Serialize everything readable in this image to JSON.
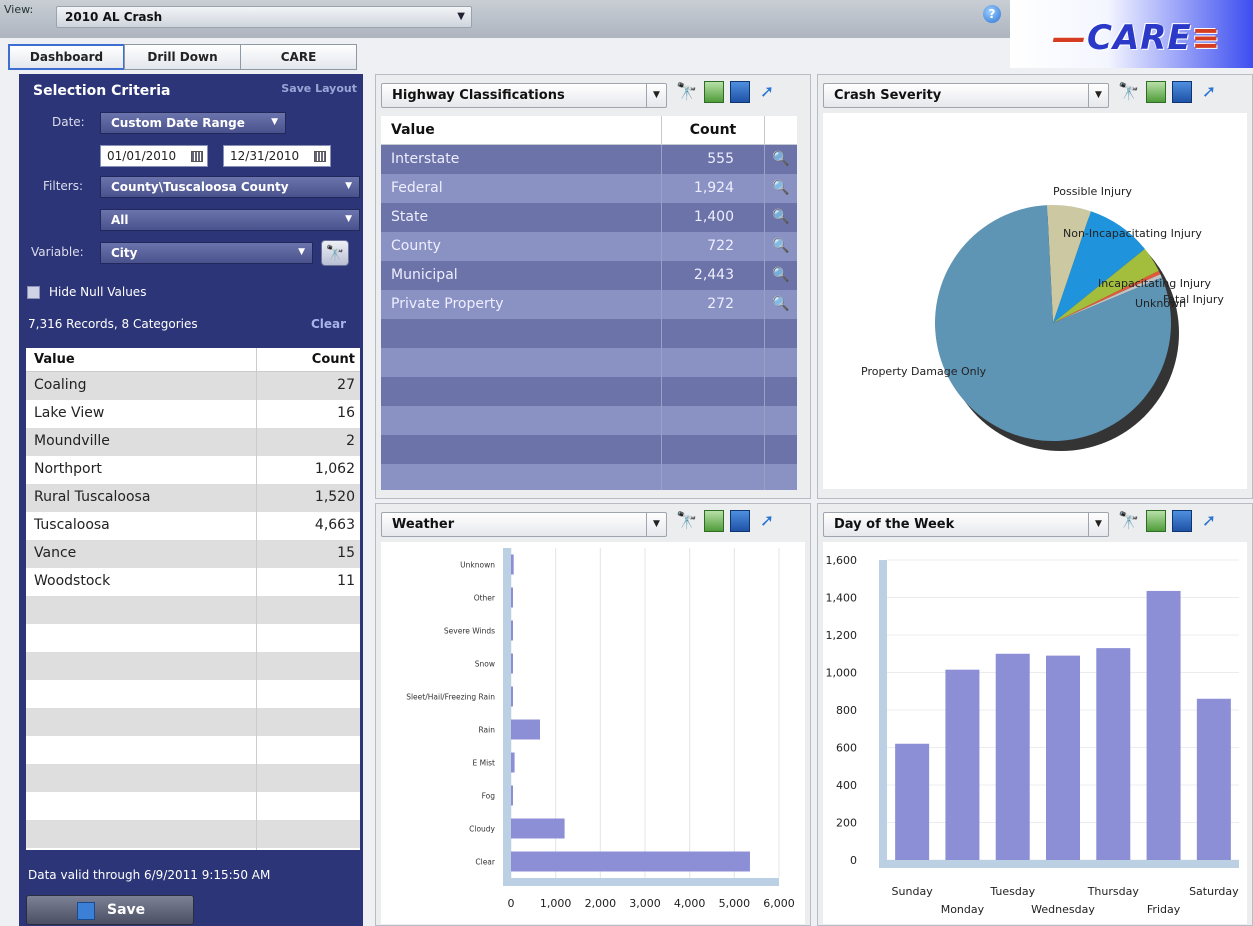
{
  "header": {
    "view_label": "View:",
    "view_value": "2010 AL Crash",
    "help": "?",
    "logo": "CARE"
  },
  "tabs": [
    {
      "label": "Dashboard",
      "active": true
    },
    {
      "label": "Drill Down",
      "active": false
    },
    {
      "label": "CARE",
      "active": false
    }
  ],
  "selection": {
    "title": "Selection Criteria",
    "save_layout": "Save Layout",
    "date_label": "Date:",
    "date_range": "Custom Date Range",
    "start_date": "01/01/2010",
    "end_date": "12/31/2010",
    "filters_label": "Filters:",
    "filter1": "County\\Tuscaloosa County",
    "filter2": "All",
    "variable_label": "Variable:",
    "variable": "City",
    "hide_null": "Hide Null Values",
    "records": "7,316 Records, 8 Categories",
    "clear": "Clear",
    "table_headers": {
      "value": "Value",
      "count": "Count"
    },
    "rows": [
      {
        "value": "Coaling",
        "count": "27"
      },
      {
        "value": "Lake View",
        "count": "16"
      },
      {
        "value": "Moundville",
        "count": "2"
      },
      {
        "value": "Northport",
        "count": "1,062"
      },
      {
        "value": "Rural Tuscaloosa",
        "count": "1,520"
      },
      {
        "value": "Tuscaloosa",
        "count": "4,663"
      },
      {
        "value": "Vance",
        "count": "15"
      },
      {
        "value": "Woodstock",
        "count": "11"
      }
    ],
    "data_valid": "Data valid through 6/9/2011 9:15:50 AM",
    "save": "Save"
  },
  "panels": {
    "highway": {
      "title": "Highway Classifications",
      "headers": {
        "value": "Value",
        "count": "Count"
      },
      "rows": [
        {
          "value": "Interstate",
          "count": "555"
        },
        {
          "value": "Federal",
          "count": "1,924"
        },
        {
          "value": "State",
          "count": "1,400"
        },
        {
          "value": "County",
          "count": "722"
        },
        {
          "value": "Municipal",
          "count": "2,443"
        },
        {
          "value": "Private Property",
          "count": "272"
        }
      ]
    },
    "severity": {
      "title": "Crash Severity"
    },
    "weather": {
      "title": "Weather"
    },
    "dow": {
      "title": "Day of the Week"
    }
  },
  "chart_data": [
    {
      "type": "pie",
      "title": "Crash Severity",
      "labels": [
        "Property Damage Only",
        "Possible Injury",
        "Non-Incapacitating Injury",
        "Incapacitating Injury",
        "Fatal Injury",
        "Unknown"
      ],
      "values": [
        80.5,
        6.0,
        9.0,
        3.5,
        0.5,
        0.5
      ],
      "colors": [
        "#5e94b4",
        "#cbc8a2",
        "#1f93dc",
        "#a3bd3d",
        "#e05a3a",
        "#c0c4c8"
      ]
    },
    {
      "type": "bar",
      "orientation": "horizontal",
      "title": "Weather",
      "categories": [
        "Unknown",
        "Other",
        "Severe Winds",
        "Snow",
        "Sleet/Hail/Freezing Rain",
        "Rain",
        "E Mist",
        "Fog",
        "Cloudy",
        "Clear"
      ],
      "values": [
        60,
        10,
        5,
        20,
        30,
        650,
        80,
        40,
        1200,
        5350
      ],
      "xlim": [
        0,
        6000
      ],
      "xticks": [
        "0",
        "1,000",
        "2,000",
        "3,000",
        "4,000",
        "5,000",
        "6,000"
      ],
      "color": "#8c8fd6"
    },
    {
      "type": "bar",
      "title": "Day of the Week",
      "categories": [
        "Sunday",
        "Monday",
        "Tuesday",
        "Wednesday",
        "Thursday",
        "Friday",
        "Saturday"
      ],
      "values": [
        620,
        1015,
        1100,
        1090,
        1130,
        1435,
        860
      ],
      "ylim": [
        0,
        1600
      ],
      "yticks": [
        "0",
        "200",
        "400",
        "600",
        "800",
        "1,000",
        "1,200",
        "1,400",
        "1,600"
      ],
      "color": "#8c8fd6"
    }
  ]
}
